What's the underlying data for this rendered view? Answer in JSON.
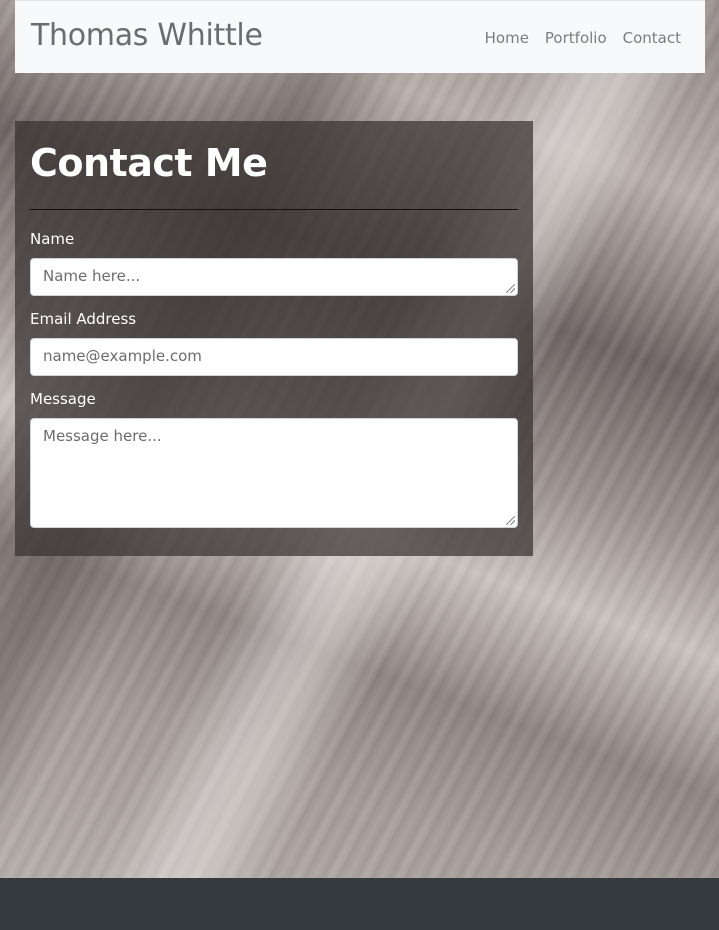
{
  "header": {
    "brand": "Thomas Whittle",
    "nav": [
      {
        "label": "Home"
      },
      {
        "label": "Portfolio"
      },
      {
        "label": "Contact"
      }
    ]
  },
  "contact": {
    "title": "Contact Me",
    "name_label": "Name",
    "name_placeholder": "Name here...",
    "email_label": "Email Address",
    "email_placeholder": "name@example.com",
    "message_label": "Message",
    "message_placeholder": "Message here..."
  },
  "colors": {
    "navbar": "#f8f9fa",
    "footer": "#343a40",
    "card": "#373231"
  }
}
